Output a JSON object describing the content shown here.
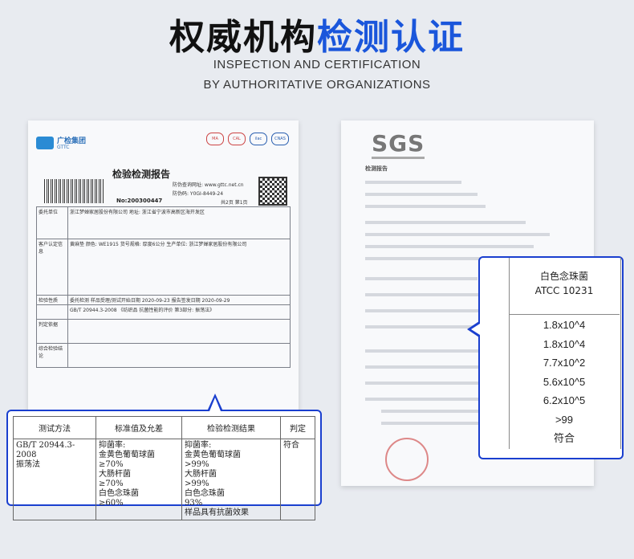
{
  "header": {
    "title_dark": "权威机构",
    "title_blue": "检测认证",
    "subtitle_line1": "INSPECTION AND CERTIFICATION",
    "subtitle_line2": "BY AUTHORITATIVE ORGANIZATIONS"
  },
  "colors": {
    "accent": "#1a56db",
    "popup_border": "#1a3fcf"
  },
  "left_doc": {
    "org_name": "广检集团",
    "org_sub": "GTTC",
    "report_title": "检验检测报告",
    "report_query": "防伪查询网址: www.gttc.net.cn",
    "report_code": "防伪码: Y0GI-8449-24",
    "page_info": "共2页 第1页",
    "report_no": "No:200300447",
    "badges": [
      "MA",
      "CAL",
      "ilac",
      "CNAS"
    ],
    "rows": [
      {
        "label": "委托单位",
        "value": "浙江梦婵家居股份有限公司 地址: 浙江省宁波市高新区海开发区"
      },
      {
        "label": "客户认定信息",
        "value": "黄麻垫 颜色: WE1915 货号规格: 厚度6公分 生产单位: 浙江梦婵家居股份有限公司"
      },
      {
        "label": "检验性质",
        "value": "委托检测  样品受理/测试开始日期 2020-09-23  报告签发日期 2020-09-29"
      },
      {
        "label": "",
        "value": "GB/T 20944.3-2008 《纺织品 抗菌性能的评价 第3部分: 振荡法》"
      },
      {
        "label": "判定依据",
        "value": ""
      },
      {
        "label": "综合检验结论",
        "value": ""
      }
    ]
  },
  "right_doc": {
    "logo": "SGS",
    "heading": "检测报告"
  },
  "popup_left": {
    "headers": [
      "测试方法",
      "标准值及允差",
      "检验检测结果",
      "判定"
    ],
    "method": [
      "GB/T 20944.3-2008",
      "振荡法"
    ],
    "standard": [
      "抑菌率:",
      "金黄色葡萄球菌",
      "≥70%",
      "大肠杆菌",
      "≥70%",
      "白色念珠菌",
      "≥60%"
    ],
    "result": [
      "抑菌率:",
      "金黄色葡萄球菌",
      ">99%",
      "大肠杆菌",
      ">99%",
      "白色念珠菌",
      "93%",
      "样品具有抗菌效果"
    ],
    "verdict": "符合"
  },
  "popup_right": {
    "header_line1": "白色念珠菌",
    "header_line2": "ATCC 10231",
    "values": [
      "1.8x10^4",
      "1.8x10^4",
      "7.7x10^2",
      "5.6x10^5",
      "6.2x10^5",
      ">99",
      "符合"
    ]
  }
}
